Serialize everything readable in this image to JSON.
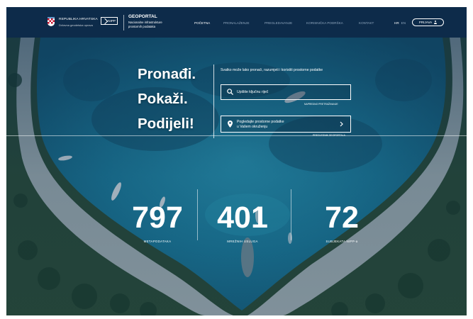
{
  "header": {
    "org_name": "REPUBLIKA HRVATSKA",
    "org_sub": "Državna geodetska uprava",
    "nipp_logo": "NIPP",
    "portal_title": "GEOPORTAL",
    "portal_sub1": "Nacionalne infrastrukture",
    "portal_sub2": "prostornih podataka",
    "nav": [
      {
        "label": "POČETNA",
        "active": true
      },
      {
        "label": "PRONALAŽENJE",
        "active": false
      },
      {
        "label": "PREGLEDAVANJE",
        "active": false
      },
      {
        "label": "KORISNIČKA PODRŠKA",
        "active": false
      },
      {
        "label": "KONTAKT",
        "active": false
      }
    ],
    "lang_hr": "HR",
    "lang_en": "EN",
    "login_label": "PRIJAVA"
  },
  "hero": {
    "tagline": [
      "Pronađi.",
      "Pokaži.",
      "Podijeli!"
    ],
    "intro": "Svatko može lako pronaći, razumjeti i koristiti prostorne podatke",
    "search_placeholder": "Upišite ključnu riječ",
    "advanced_search": "NAPREDNO PRETRAŽIVANJE",
    "nearby_line1": "Pogledajte prostorne podatke",
    "nearby_line2": "u Vašem okruženju",
    "geolocation_link": "PREGLEDNIK GEOPORTALA"
  },
  "stats": [
    {
      "value": "797",
      "label": "METAPODATAKA"
    },
    {
      "value": "401",
      "label": "MREŽNIH USLUGA"
    },
    {
      "value": "72",
      "label": "SUBJEKATA NIPP-a"
    }
  ],
  "colors": {
    "header_bg": "#0d2b4a",
    "nav_inactive": "#8fa6bd",
    "water": "#1f8aa8",
    "shore": "#b9c2c6",
    "forest": "#24452f"
  },
  "icons": {
    "search": "search-icon",
    "pin": "location-pin-icon",
    "chevron": "chevron-right-icon",
    "user": "user-icon",
    "crest": "croatian-crest-icon"
  }
}
